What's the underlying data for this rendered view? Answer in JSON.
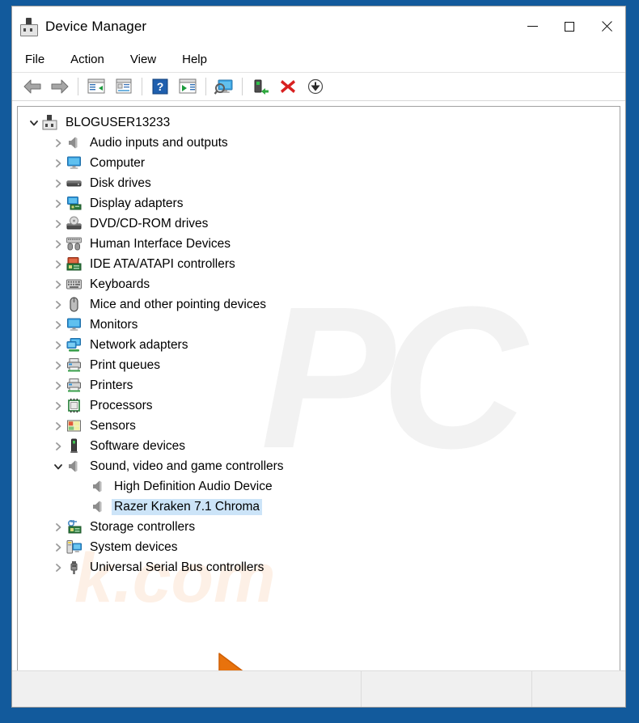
{
  "window": {
    "title": "Device Manager",
    "app_icon": "device-manager-plug-icon",
    "controls": {
      "minimize": "minimize-icon",
      "maximize": "maximize-icon",
      "close": "close-icon"
    }
  },
  "menubar": {
    "items": [
      "File",
      "Action",
      "View",
      "Help"
    ]
  },
  "toolbar": {
    "buttons": [
      {
        "name": "back-button",
        "icon": "arrow-left-icon"
      },
      {
        "name": "forward-button",
        "icon": "arrow-right-icon"
      },
      {
        "name": "separator-1",
        "icon": "separator"
      },
      {
        "name": "show-hide-console-tree-button",
        "icon": "console-tree-icon"
      },
      {
        "name": "properties-button",
        "icon": "properties-icon"
      },
      {
        "name": "separator-2",
        "icon": "separator"
      },
      {
        "name": "help-button",
        "icon": "help-question-icon"
      },
      {
        "name": "update-driver-button",
        "icon": "update-driver-icon"
      },
      {
        "name": "separator-3",
        "icon": "separator"
      },
      {
        "name": "scan-for-hardware-changes-button",
        "icon": "scan-monitor-icon"
      },
      {
        "name": "separator-4",
        "icon": "separator"
      },
      {
        "name": "enable-device-button",
        "icon": "enable-device-icon"
      },
      {
        "name": "uninstall-device-button",
        "icon": "red-x-icon"
      },
      {
        "name": "add-legacy-hardware-button",
        "icon": "down-arrow-circle-icon"
      }
    ]
  },
  "tree": {
    "root": {
      "label": "BLOGUSER13233",
      "icon": "computer-plug-icon",
      "expanded": true,
      "level": 0
    },
    "items": [
      {
        "label": "Audio inputs and outputs",
        "icon": "speaker-icon",
        "level": 1,
        "expanded": false,
        "selected": false
      },
      {
        "label": "Computer",
        "icon": "monitor-icon",
        "level": 1,
        "expanded": false,
        "selected": false
      },
      {
        "label": "Disk drives",
        "icon": "disk-drive-icon",
        "level": 1,
        "expanded": false,
        "selected": false
      },
      {
        "label": "Display adapters",
        "icon": "display-adapter-icon",
        "level": 1,
        "expanded": false,
        "selected": false
      },
      {
        "label": "DVD/CD-ROM drives",
        "icon": "optical-drive-icon",
        "level": 1,
        "expanded": false,
        "selected": false
      },
      {
        "label": "Human Interface Devices",
        "icon": "hid-icon",
        "level": 1,
        "expanded": false,
        "selected": false
      },
      {
        "label": "IDE ATA/ATAPI controllers",
        "icon": "ide-controller-icon",
        "level": 1,
        "expanded": false,
        "selected": false
      },
      {
        "label": "Keyboards",
        "icon": "keyboard-icon",
        "level": 1,
        "expanded": false,
        "selected": false
      },
      {
        "label": "Mice and other pointing devices",
        "icon": "mouse-icon",
        "level": 1,
        "expanded": false,
        "selected": false
      },
      {
        "label": "Monitors",
        "icon": "monitor-icon",
        "level": 1,
        "expanded": false,
        "selected": false
      },
      {
        "label": "Network adapters",
        "icon": "network-adapter-icon",
        "level": 1,
        "expanded": false,
        "selected": false
      },
      {
        "label": "Print queues",
        "icon": "printer-icon",
        "level": 1,
        "expanded": false,
        "selected": false
      },
      {
        "label": "Printers",
        "icon": "printer-icon",
        "level": 1,
        "expanded": false,
        "selected": false
      },
      {
        "label": "Processors",
        "icon": "processor-icon",
        "level": 1,
        "expanded": false,
        "selected": false
      },
      {
        "label": "Sensors",
        "icon": "sensor-icon",
        "level": 1,
        "expanded": false,
        "selected": false
      },
      {
        "label": "Software devices",
        "icon": "software-device-icon",
        "level": 1,
        "expanded": false,
        "selected": false
      },
      {
        "label": "Sound, video and game controllers",
        "icon": "speaker-icon",
        "level": 1,
        "expanded": true,
        "selected": false
      },
      {
        "label": "High Definition Audio Device",
        "icon": "speaker-icon",
        "level": 2,
        "expanded": null,
        "selected": false
      },
      {
        "label": "Razer Kraken 7.1 Chroma",
        "icon": "speaker-icon",
        "level": 2,
        "expanded": null,
        "selected": true
      },
      {
        "label": "Storage controllers",
        "icon": "storage-controller-icon",
        "level": 1,
        "expanded": false,
        "selected": false
      },
      {
        "label": "System devices",
        "icon": "system-device-icon",
        "level": 1,
        "expanded": false,
        "selected": false
      },
      {
        "label": "Universal Serial Bus controllers",
        "icon": "usb-icon",
        "level": 1,
        "expanded": false,
        "selected": false
      }
    ]
  },
  "watermark": {
    "primary": "PC",
    "secondary": "k.com"
  },
  "statusbar": {
    "pane1": "",
    "pane2": "",
    "pane3": ""
  },
  "cursor": {
    "icon": "orange-arrow-cursor",
    "color": "#e8720c"
  },
  "colors": {
    "selection": "#cce4f8",
    "desktop": "#125a9c",
    "window_bg": "#ffffff",
    "statusbar_bg": "#f0f0f0",
    "watermark_gray": "#f2f2f2",
    "watermark_orange": "#fdf0e6"
  }
}
